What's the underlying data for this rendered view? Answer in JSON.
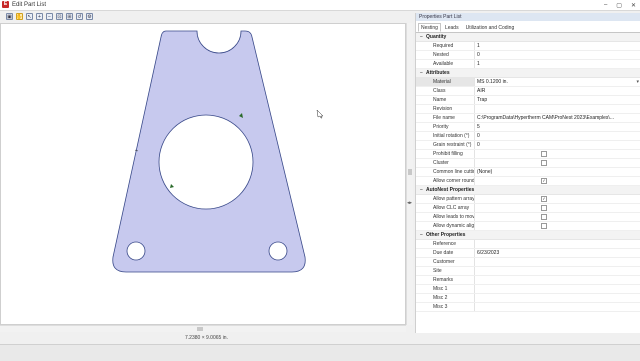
{
  "window": {
    "title": "Edit Part List",
    "app_icon": "E",
    "buttons": [
      "–",
      "▢",
      "✕"
    ]
  },
  "toolbar": {
    "icons": [
      "fit-icon",
      "pan-icon",
      "select-icon",
      "zoom-in-icon",
      "zoom-out-icon",
      "zoom-window-icon",
      "zoom-extents-icon",
      "zoom-previous-icon",
      "settings-icon"
    ]
  },
  "status": {
    "dimensions": "7.2380 × 9.0065 in."
  },
  "panel": {
    "title": "Properties Part List",
    "tabs": [
      "Nesting",
      "Leads",
      "Utilization and Coding"
    ],
    "categories": [
      {
        "name": "Quantity",
        "rows": [
          {
            "key": "Required",
            "value": "1"
          },
          {
            "key": "Nested",
            "value": "0"
          },
          {
            "key": "Available",
            "value": "1"
          }
        ]
      },
      {
        "name": "Attributes",
        "rows": [
          {
            "key": "Material",
            "value": "MS 0.1200 in.",
            "selected": true,
            "dropdown": true
          },
          {
            "key": "Class",
            "value": "AIR"
          },
          {
            "key": "Name",
            "value": "Trap"
          },
          {
            "key": "Revision",
            "value": ""
          },
          {
            "key": "File name",
            "value": "C:\\ProgramData\\Hypertherm CAM\\ProNest 2023\\Examples\\..."
          },
          {
            "key": "Priority",
            "value": "5"
          },
          {
            "key": "Initial rotation (°)",
            "value": "0"
          },
          {
            "key": "Grain restraint (°)",
            "value": "0"
          },
          {
            "key": "Prohibit filling",
            "value": "",
            "checkbox": false
          },
          {
            "key": "Cluster",
            "value": "",
            "checkbox": false
          },
          {
            "key": "Common line cutting",
            "value": "(None)"
          },
          {
            "key": "Allow corner rounding",
            "value": "",
            "checkbox": true
          }
        ]
      },
      {
        "name": "AutoNest Properties",
        "rows": [
          {
            "key": "Allow pattern array",
            "value": "",
            "checkbox": true
          },
          {
            "key": "Allow CLC array",
            "value": "",
            "checkbox": false
          },
          {
            "key": "Allow leads to move",
            "value": "",
            "checkbox": false
          },
          {
            "key": "Allow dynamic align",
            "value": "",
            "checkbox": false
          }
        ]
      },
      {
        "name": "Other Properties",
        "rows": [
          {
            "key": "Reference",
            "value": ""
          },
          {
            "key": "Due date",
            "value": "6/23/2023"
          },
          {
            "key": "Customer",
            "value": ""
          },
          {
            "key": "Site",
            "value": ""
          },
          {
            "key": "Remarks",
            "value": ""
          },
          {
            "key": "Misc 1",
            "value": ""
          },
          {
            "key": "Misc 2",
            "value": ""
          },
          {
            "key": "Misc 3",
            "value": ""
          }
        ]
      }
    ]
  },
  "colors": {
    "part_fill": "#c7c9ee",
    "part_stroke": "#3a4a8a",
    "accent": "#c62828"
  }
}
